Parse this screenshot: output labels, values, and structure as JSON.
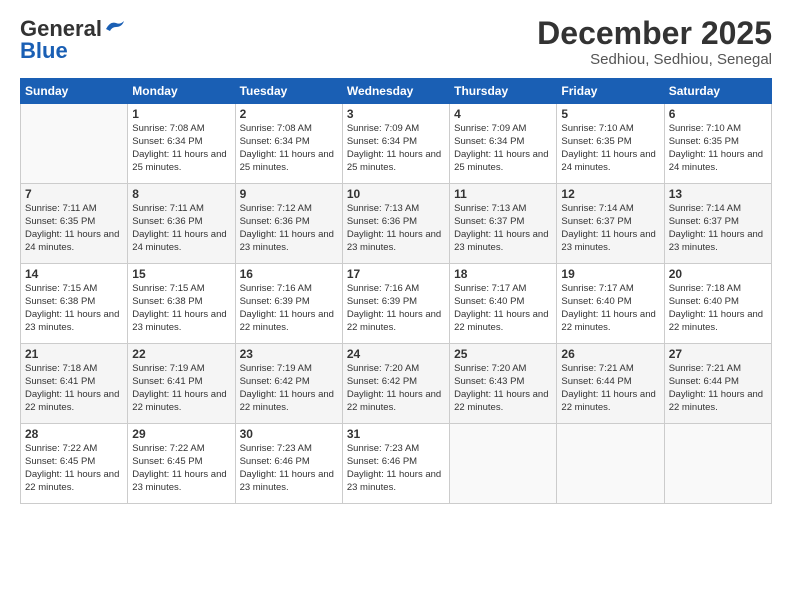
{
  "header": {
    "logo_general": "General",
    "logo_blue": "Blue",
    "month_title": "December 2025",
    "location": "Sedhiou, Sedhiou, Senegal"
  },
  "days_of_week": [
    "Sunday",
    "Monday",
    "Tuesday",
    "Wednesday",
    "Thursday",
    "Friday",
    "Saturday"
  ],
  "weeks": [
    [
      {
        "day": "",
        "sunrise": "",
        "sunset": "",
        "daylight": ""
      },
      {
        "day": "1",
        "sunrise": "Sunrise: 7:08 AM",
        "sunset": "Sunset: 6:34 PM",
        "daylight": "Daylight: 11 hours and 25 minutes."
      },
      {
        "day": "2",
        "sunrise": "Sunrise: 7:08 AM",
        "sunset": "Sunset: 6:34 PM",
        "daylight": "Daylight: 11 hours and 25 minutes."
      },
      {
        "day": "3",
        "sunrise": "Sunrise: 7:09 AM",
        "sunset": "Sunset: 6:34 PM",
        "daylight": "Daylight: 11 hours and 25 minutes."
      },
      {
        "day": "4",
        "sunrise": "Sunrise: 7:09 AM",
        "sunset": "Sunset: 6:34 PM",
        "daylight": "Daylight: 11 hours and 25 minutes."
      },
      {
        "day": "5",
        "sunrise": "Sunrise: 7:10 AM",
        "sunset": "Sunset: 6:35 PM",
        "daylight": "Daylight: 11 hours and 24 minutes."
      },
      {
        "day": "6",
        "sunrise": "Sunrise: 7:10 AM",
        "sunset": "Sunset: 6:35 PM",
        "daylight": "Daylight: 11 hours and 24 minutes."
      }
    ],
    [
      {
        "day": "7",
        "sunrise": "Sunrise: 7:11 AM",
        "sunset": "Sunset: 6:35 PM",
        "daylight": "Daylight: 11 hours and 24 minutes."
      },
      {
        "day": "8",
        "sunrise": "Sunrise: 7:11 AM",
        "sunset": "Sunset: 6:36 PM",
        "daylight": "Daylight: 11 hours and 24 minutes."
      },
      {
        "day": "9",
        "sunrise": "Sunrise: 7:12 AM",
        "sunset": "Sunset: 6:36 PM",
        "daylight": "Daylight: 11 hours and 23 minutes."
      },
      {
        "day": "10",
        "sunrise": "Sunrise: 7:13 AM",
        "sunset": "Sunset: 6:36 PM",
        "daylight": "Daylight: 11 hours and 23 minutes."
      },
      {
        "day": "11",
        "sunrise": "Sunrise: 7:13 AM",
        "sunset": "Sunset: 6:37 PM",
        "daylight": "Daylight: 11 hours and 23 minutes."
      },
      {
        "day": "12",
        "sunrise": "Sunrise: 7:14 AM",
        "sunset": "Sunset: 6:37 PM",
        "daylight": "Daylight: 11 hours and 23 minutes."
      },
      {
        "day": "13",
        "sunrise": "Sunrise: 7:14 AM",
        "sunset": "Sunset: 6:37 PM",
        "daylight": "Daylight: 11 hours and 23 minutes."
      }
    ],
    [
      {
        "day": "14",
        "sunrise": "Sunrise: 7:15 AM",
        "sunset": "Sunset: 6:38 PM",
        "daylight": "Daylight: 11 hours and 23 minutes."
      },
      {
        "day": "15",
        "sunrise": "Sunrise: 7:15 AM",
        "sunset": "Sunset: 6:38 PM",
        "daylight": "Daylight: 11 hours and 23 minutes."
      },
      {
        "day": "16",
        "sunrise": "Sunrise: 7:16 AM",
        "sunset": "Sunset: 6:39 PM",
        "daylight": "Daylight: 11 hours and 22 minutes."
      },
      {
        "day": "17",
        "sunrise": "Sunrise: 7:16 AM",
        "sunset": "Sunset: 6:39 PM",
        "daylight": "Daylight: 11 hours and 22 minutes."
      },
      {
        "day": "18",
        "sunrise": "Sunrise: 7:17 AM",
        "sunset": "Sunset: 6:40 PM",
        "daylight": "Daylight: 11 hours and 22 minutes."
      },
      {
        "day": "19",
        "sunrise": "Sunrise: 7:17 AM",
        "sunset": "Sunset: 6:40 PM",
        "daylight": "Daylight: 11 hours and 22 minutes."
      },
      {
        "day": "20",
        "sunrise": "Sunrise: 7:18 AM",
        "sunset": "Sunset: 6:40 PM",
        "daylight": "Daylight: 11 hours and 22 minutes."
      }
    ],
    [
      {
        "day": "21",
        "sunrise": "Sunrise: 7:18 AM",
        "sunset": "Sunset: 6:41 PM",
        "daylight": "Daylight: 11 hours and 22 minutes."
      },
      {
        "day": "22",
        "sunrise": "Sunrise: 7:19 AM",
        "sunset": "Sunset: 6:41 PM",
        "daylight": "Daylight: 11 hours and 22 minutes."
      },
      {
        "day": "23",
        "sunrise": "Sunrise: 7:19 AM",
        "sunset": "Sunset: 6:42 PM",
        "daylight": "Daylight: 11 hours and 22 minutes."
      },
      {
        "day": "24",
        "sunrise": "Sunrise: 7:20 AM",
        "sunset": "Sunset: 6:42 PM",
        "daylight": "Daylight: 11 hours and 22 minutes."
      },
      {
        "day": "25",
        "sunrise": "Sunrise: 7:20 AM",
        "sunset": "Sunset: 6:43 PM",
        "daylight": "Daylight: 11 hours and 22 minutes."
      },
      {
        "day": "26",
        "sunrise": "Sunrise: 7:21 AM",
        "sunset": "Sunset: 6:44 PM",
        "daylight": "Daylight: 11 hours and 22 minutes."
      },
      {
        "day": "27",
        "sunrise": "Sunrise: 7:21 AM",
        "sunset": "Sunset: 6:44 PM",
        "daylight": "Daylight: 11 hours and 22 minutes."
      }
    ],
    [
      {
        "day": "28",
        "sunrise": "Sunrise: 7:22 AM",
        "sunset": "Sunset: 6:45 PM",
        "daylight": "Daylight: 11 hours and 22 minutes."
      },
      {
        "day": "29",
        "sunrise": "Sunrise: 7:22 AM",
        "sunset": "Sunset: 6:45 PM",
        "daylight": "Daylight: 11 hours and 23 minutes."
      },
      {
        "day": "30",
        "sunrise": "Sunrise: 7:23 AM",
        "sunset": "Sunset: 6:46 PM",
        "daylight": "Daylight: 11 hours and 23 minutes."
      },
      {
        "day": "31",
        "sunrise": "Sunrise: 7:23 AM",
        "sunset": "Sunset: 6:46 PM",
        "daylight": "Daylight: 11 hours and 23 minutes."
      },
      {
        "day": "",
        "sunrise": "",
        "sunset": "",
        "daylight": ""
      },
      {
        "day": "",
        "sunrise": "",
        "sunset": "",
        "daylight": ""
      },
      {
        "day": "",
        "sunrise": "",
        "sunset": "",
        "daylight": ""
      }
    ]
  ]
}
